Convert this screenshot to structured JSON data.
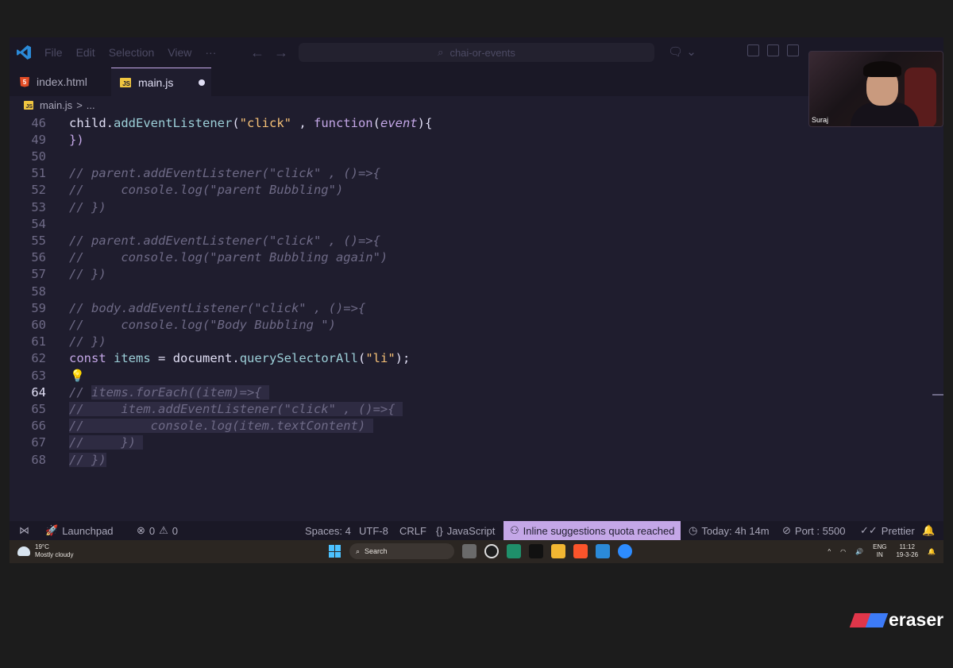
{
  "window": {
    "menu": [
      "File",
      "Edit",
      "Selection",
      "View",
      "···"
    ],
    "search_text": "chai-or-events"
  },
  "tabs": [
    {
      "label": "index.html",
      "icon": "html-icon"
    },
    {
      "label": "main.js",
      "icon": "js-icon",
      "modified": true
    }
  ],
  "breadcrumb": {
    "file": "main.js",
    "sep": ">",
    "rest": "..."
  },
  "editor": {
    "lines": [
      {
        "n": "46",
        "tokens": [
          [
            "",
            "child."
          ],
          [
            "fn",
            "addEventListener"
          ],
          [
            "",
            "("
          ],
          [
            "str",
            "\"click\""
          ],
          [
            "",
            " , "
          ],
          [
            "kw",
            "function"
          ],
          [
            "",
            "("
          ],
          [
            "param",
            "event"
          ],
          [
            "",
            "){"
          ]
        ]
      },
      {
        "n": "49",
        "tokens": [
          [
            "kw",
            "})"
          ]
        ]
      },
      {
        "n": "50",
        "tokens": []
      },
      {
        "n": "51",
        "tokens": [
          [
            "cm",
            "// parent.addEventListener(\"click\" , ()=>{"
          ]
        ]
      },
      {
        "n": "52",
        "tokens": [
          [
            "cm",
            "//     console.log(\"parent Bubbling\")"
          ]
        ]
      },
      {
        "n": "53",
        "tokens": [
          [
            "cm",
            "// })"
          ]
        ]
      },
      {
        "n": "54",
        "tokens": []
      },
      {
        "n": "55",
        "tokens": [
          [
            "cm",
            "// parent.addEventListener(\"click\" , ()=>{"
          ]
        ]
      },
      {
        "n": "56",
        "tokens": [
          [
            "cm",
            "//     console.log(\"parent Bubbling again\")"
          ]
        ]
      },
      {
        "n": "57",
        "tokens": [
          [
            "cm",
            "// })"
          ]
        ]
      },
      {
        "n": "58",
        "tokens": []
      },
      {
        "n": "59",
        "tokens": [
          [
            "cm",
            "// body.addEventListener(\"click\" , ()=>{"
          ]
        ]
      },
      {
        "n": "60",
        "tokens": [
          [
            "cm",
            "//     console.log(\"Body Bubbling \")"
          ]
        ]
      },
      {
        "n": "61",
        "tokens": [
          [
            "cm",
            "// })"
          ]
        ]
      },
      {
        "n": "62",
        "tokens": [
          [
            "kw",
            "const"
          ],
          [
            "",
            " "
          ],
          [
            "fn",
            "items"
          ],
          [
            "",
            " = "
          ],
          [
            "",
            "document."
          ],
          [
            "fn",
            "querySelectorAll"
          ],
          [
            "",
            "("
          ],
          [
            "str",
            "\"li\""
          ],
          [
            "",
            ");"
          ]
        ]
      },
      {
        "n": "63",
        "tokens": [],
        "bulb": true
      },
      {
        "n": "64",
        "tokens": [
          [
            "cm",
            "// "
          ],
          [
            "cm sel",
            "items.forEach((item)=>{ "
          ]
        ],
        "active": true
      },
      {
        "n": "65",
        "tokens": [
          [
            "cm sel",
            "//     item.addEventListener(\"click\" , ()=>{ "
          ]
        ]
      },
      {
        "n": "66",
        "tokens": [
          [
            "cm sel",
            "//         console.log(item.textContent) "
          ]
        ]
      },
      {
        "n": "67",
        "tokens": [
          [
            "cm sel",
            "//     }) "
          ]
        ]
      },
      {
        "n": "68",
        "tokens": [
          [
            "cm sel",
            "// })"
          ]
        ]
      }
    ]
  },
  "statusbar": {
    "launchpad": "Launchpad",
    "errors": "0",
    "warnings": "0",
    "spaces": "Spaces: 4",
    "encoding": "UTF-8",
    "eol": "CRLF",
    "language": "JavaScript",
    "copilot": "Inline suggestions quota reached",
    "time": "Today: 4h 14m",
    "port": "Port : 5500",
    "prettier": "Prettier"
  },
  "taskbar": {
    "temp": "19°C",
    "weather": "Mostly cloudy",
    "search": "Search",
    "lang": "ENG",
    "region": "IN",
    "time": "11:12",
    "date": "19-3-26"
  },
  "webcam": {
    "name": "Suraj"
  },
  "watermark": "eraser",
  "colors": {
    "accent": "#c4a7e7",
    "bg": "#1f1d2e",
    "string": "#f6c177",
    "function": "#9ccfd8",
    "comment": "#6e6a86"
  }
}
